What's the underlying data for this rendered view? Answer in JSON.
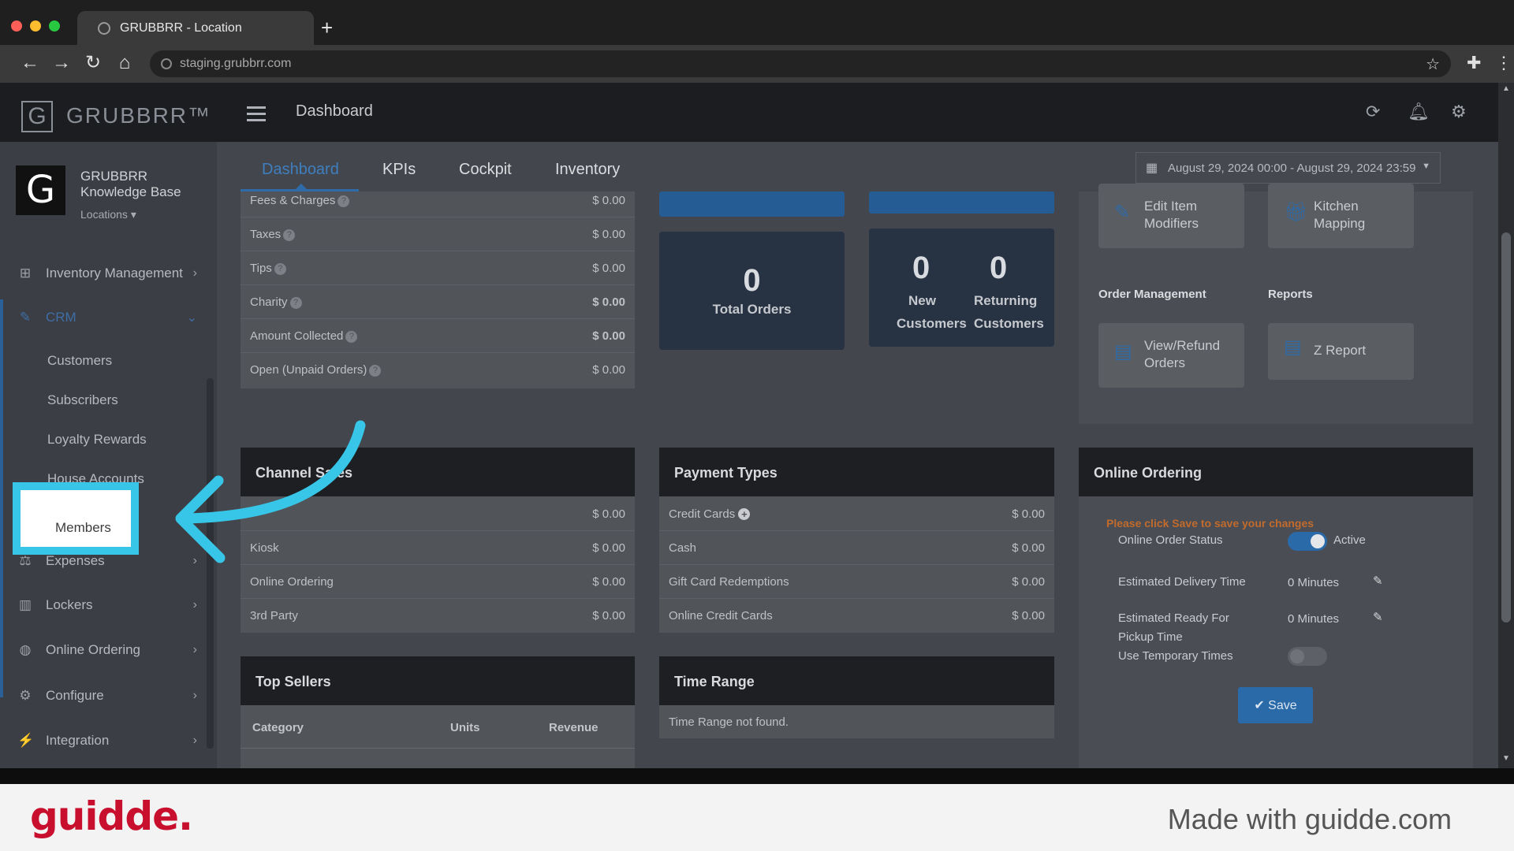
{
  "browser": {
    "tab_title": "GRUBBRR - Location",
    "new_tab": "+",
    "url": "staging.grubbrr.com",
    "icons": {
      "back": "arrow-left-icon",
      "forward": "arrow-right-icon",
      "reload": "reload-icon",
      "home": "home-icon",
      "star": "star-icon",
      "extensions": "puzzle-icon",
      "menu": "kebab-menu-icon"
    }
  },
  "header": {
    "logo_letter": "G",
    "logo_text": "GRUBBRR™",
    "title": "Dashboard",
    "icons": [
      "refresh-icon",
      "bell-icon",
      "gear-icon"
    ]
  },
  "sidebar": {
    "org_letter": "G",
    "org_name": "GRUBBRR Knowledge Base",
    "locations": "Locations ▾",
    "items": [
      {
        "label": "Inventory Management",
        "icon": "sitemap-icon"
      },
      {
        "label": "CRM",
        "icon": "users-icon"
      },
      {
        "label": "Expenses",
        "icon": "scale-icon"
      },
      {
        "label": "Lockers",
        "icon": "locker-icon"
      },
      {
        "label": "Online Ordering",
        "icon": "globe-icon"
      },
      {
        "label": "Configure",
        "icon": "cog-icon"
      },
      {
        "label": "Integration",
        "icon": "plug-icon"
      }
    ],
    "crm_sub": [
      "Customers",
      "Subscribers",
      "Loyalty Rewards",
      "House Accounts",
      "Members"
    ]
  },
  "tabs": [
    "Dashboard",
    "KPIs",
    "Cockpit",
    "Inventory"
  ],
  "date_range": "August 29, 2024 00:00 - August 29, 2024 23:59",
  "summary_rows": [
    {
      "label": "Fees & Charges",
      "value": "$ 0.00"
    },
    {
      "label": "Taxes",
      "value": "$ 0.00"
    },
    {
      "label": "Tips",
      "value": "$ 0.00"
    },
    {
      "label": "Charity",
      "value": "$ 0.00"
    },
    {
      "label": "Amount Collected",
      "value": "$ 0.00"
    },
    {
      "label": "Open (Unpaid Orders)",
      "value": "$ 0.00"
    }
  ],
  "stats": {
    "total_orders": {
      "value": "0",
      "label": "Total Orders"
    },
    "new_customers": {
      "value": "0",
      "label1": "New",
      "label2": "Customers"
    },
    "returning_customers": {
      "value": "0",
      "label1": "Returning",
      "label2": "Customers"
    }
  },
  "quick_actions": {
    "edit_item_modifiers": [
      "Edit Item",
      "Modifiers"
    ],
    "kitchen_mapping": [
      "Kitchen",
      "Mapping"
    ],
    "order_management_heading": "Order Management",
    "reports_heading": "Reports",
    "view_refund_orders": [
      "View/Refund",
      "Orders"
    ],
    "z_report": "Z Report"
  },
  "channel_sales": {
    "title": "Channel Sales",
    "rows": [
      {
        "label": "",
        "value": "$ 0.00"
      },
      {
        "label": "Kiosk",
        "value": "$ 0.00"
      },
      {
        "label": "Online Ordering",
        "value": "$ 0.00"
      },
      {
        "label": "3rd Party",
        "value": "$ 0.00"
      }
    ]
  },
  "payment_types": {
    "title": "Payment Types",
    "rows": [
      {
        "label": "Credit Cards",
        "value": "$ 0.00"
      },
      {
        "label": "Cash",
        "value": "$ 0.00"
      },
      {
        "label": "Gift Card Redemptions",
        "value": "$ 0.00"
      },
      {
        "label": "Online Credit Cards",
        "value": "$ 0.00"
      }
    ]
  },
  "online_ordering": {
    "title": "Online Ordering",
    "notice": "Please click Save to save your changes",
    "status_label": "Online Order Status",
    "status_value": "Active",
    "status_on": true,
    "delivery_label": "Estimated Delivery Time",
    "delivery_value": "0 Minutes",
    "ready_label_1": "Estimated Ready For",
    "ready_label_2": "Pickup Time",
    "ready_value": "0 Minutes",
    "temp_label": "Use Temporary Times",
    "temp_on": false,
    "save": "✔ Save"
  },
  "top_sellers": {
    "title": "Top Sellers",
    "headers": [
      "Category",
      "Units",
      "Revenue"
    ]
  },
  "time_range": {
    "title": "Time Range",
    "empty": "Time Range not found."
  },
  "overlay": {
    "highlight_label": "Members",
    "accent": "#37c6e8"
  },
  "footer": {
    "brand": "guidde.",
    "made_with": "Made with guidde.com"
  }
}
